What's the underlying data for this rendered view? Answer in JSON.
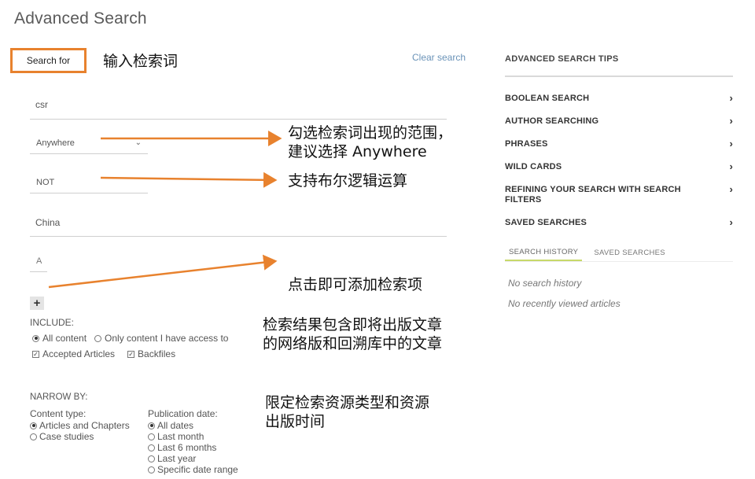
{
  "page": {
    "title": "Advanced Search"
  },
  "search": {
    "search_for_label": "Search for",
    "clear_search": "Clear search",
    "term1": "csr",
    "within": "Anywhere",
    "operator1": "NOT",
    "term2": "China",
    "operator2": "A",
    "add_icon": "plus-icon"
  },
  "include": {
    "label": "INCLUDE:",
    "access_options": [
      {
        "label": "All content",
        "selected": true
      },
      {
        "label": "Only content I have access to",
        "selected": false
      }
    ],
    "article_types": [
      {
        "label": "Accepted Articles",
        "checked": true
      },
      {
        "label": "Backfiles",
        "checked": true
      }
    ]
  },
  "narrow": {
    "label": "NARROW BY:",
    "content_type": {
      "label": "Content type:",
      "options": [
        {
          "label": "Articles and Chapters",
          "selected": true
        },
        {
          "label": "Case studies",
          "selected": false
        }
      ]
    },
    "publication_date": {
      "label": "Publication date:",
      "options": [
        {
          "label": "All dates",
          "selected": true
        },
        {
          "label": "Last month",
          "selected": false
        },
        {
          "label": "Last 6 months",
          "selected": false
        },
        {
          "label": "Last year",
          "selected": false
        },
        {
          "label": "Specific date range",
          "selected": false
        }
      ]
    }
  },
  "annotations": {
    "a1": "输入检索词",
    "a2_line1": "勾选检索词出现的范围，",
    "a2_line2": "建议选择 Anywhere",
    "a3": "支持布尔逻辑运算",
    "a4": "点击即可添加检索项",
    "a5_line1": "检索结果包含即将出版文章",
    "a5_line2": "的网络版和回溯库中的文章",
    "a6_line1": "限定检索资源类型和资源",
    "a6_line2": "出版时间",
    "arrow_color": "#e8822e"
  },
  "tips": {
    "title": "ADVANCED SEARCH TIPS",
    "items": [
      {
        "label": "BOOLEAN SEARCH"
      },
      {
        "label": "AUTHOR SEARCHING"
      },
      {
        "label": "PHRASES"
      },
      {
        "label": "WILD CARDS"
      },
      {
        "label": "REFINING YOUR SEARCH WITH SEARCH FILTERS"
      },
      {
        "label": "SAVED SEARCHES"
      }
    ],
    "chevron": "›"
  },
  "history": {
    "tabs": [
      {
        "label": "SEARCH HISTORY",
        "active": true
      },
      {
        "label": "SAVED SEARCHES",
        "active": false
      }
    ],
    "no_history": "No search history",
    "no_recent": "No recently viewed articles"
  }
}
